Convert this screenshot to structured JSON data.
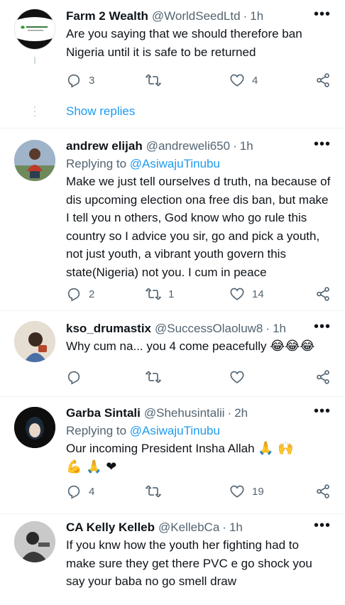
{
  "tweets": [
    {
      "name": "Farm 2 Wealth",
      "handle": "@WorldSeedLtd",
      "time": "1h",
      "text": "Are you saying that we should therefore ban Nigeria until it is safe to be returned",
      "counts": {
        "reply": "3",
        "retweet": "",
        "like": "4"
      }
    },
    {
      "name": "andrew elijah",
      "handle": "@andreweli650",
      "time": "1h",
      "replying_prefix": "Replying to ",
      "replying_to": "@AsiwajuTinubu",
      "text": "Make we just tell ourselves d truth, na because of dis upcoming election ona free dis ban, but make I tell you n others, God know who go rule this country so I advice you sir, go and pick a youth, not just youth, a vibrant youth govern this state(Nigeria) not you. I cum in peace",
      "counts": {
        "reply": "2",
        "retweet": "1",
        "like": "14"
      }
    },
    {
      "name": "kso_drumastix",
      "handle": "@SuccessOlaoluw8",
      "time": "1h",
      "text": "Why cum na... you 4 come peacefully",
      "emoji": "😂😂😂",
      "counts": {
        "reply": "",
        "retweet": "",
        "like": ""
      }
    },
    {
      "name": "Garba Sintali",
      "handle": "@Shehusintalii",
      "time": "2h",
      "replying_prefix": "Replying to ",
      "replying_to": "@AsiwajuTinubu",
      "text": "Our incoming President Insha Allah",
      "emoji": "🙏 🙌 💪 🙏 ❤",
      "counts": {
        "reply": "4",
        "retweet": "",
        "like": "19"
      }
    },
    {
      "name": "CA Kelly Kelleb",
      "handle": "@KellebCa",
      "time": "1h",
      "text": "If you knw how the youth her fighting had to make sure they get there PVC e go shock you say your baba no go smell draw"
    }
  ],
  "show_replies": "Show replies",
  "separator": "·",
  "more": "•••",
  "logo_text": "World Seed Limited",
  "colors": {
    "accent": "#1d9bf0",
    "muted": "#536471",
    "heart": "#f91880"
  }
}
